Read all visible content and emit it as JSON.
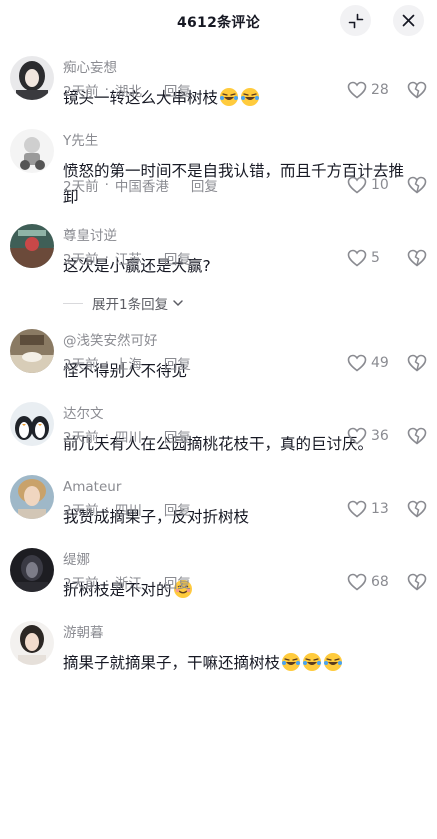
{
  "header": {
    "title": "4612条评论"
  },
  "comments": [
    {
      "username": "痴心妄想",
      "text": "镜头一转这么大串树枝",
      "emoji_count": 2,
      "time": "2天前",
      "location": "湖北",
      "reply_label": "回复",
      "likes": "28"
    },
    {
      "username": "Y先生",
      "text": "愤怒的第一时间不是自我认错，而且千方百计去推卸",
      "emoji_count": 0,
      "time": "2天前",
      "location": "中国香港",
      "reply_label": "回复",
      "likes": "10"
    },
    {
      "username": "尊皇讨逆",
      "text": "这次是小赢还是大赢?",
      "emoji_count": 0,
      "time": "2天前",
      "location": "江苏",
      "reply_label": "回复",
      "likes": "5"
    },
    {
      "username": "@浅笑安然可好",
      "text": "怪不得别人不待见",
      "emoji_count": 0,
      "time": "2天前",
      "location": "上海",
      "reply_label": "回复",
      "likes": "49"
    },
    {
      "username": "达尔文",
      "text": "前几天有人在公园摘桃花枝干，真的巨讨厌。",
      "emoji_count": 0,
      "time": "2天前",
      "location": "四川",
      "reply_label": "回复",
      "likes": "36"
    },
    {
      "username": "Amateur",
      "text": "我赞成摘果子，反对折树枝",
      "emoji_count": 0,
      "time": "2天前",
      "location": "四川",
      "reply_label": "回复",
      "likes": "13"
    },
    {
      "username": "缇娜",
      "text": "折树枝是不对的",
      "emoji_count": 0,
      "time": "2天前",
      "location": "浙江",
      "reply_label": "回复",
      "likes": "68"
    },
    {
      "username": "游朝暮",
      "text": "摘果子就摘果子，干嘛还摘树枝",
      "emoji_count": 3
    }
  ],
  "expand_replies": {
    "label": "展开1条回复"
  },
  "icons": {
    "collapse": "collapse-icon",
    "close": "close-icon",
    "like": "heart-icon",
    "dislike": "broken-heart-icon",
    "chevron": "chevron-down-icon",
    "laugh": "laughing-tears-emoji",
    "smile": "shy-smile-emoji"
  },
  "colors": {
    "text": "#161823",
    "secondary": "#8a8b91",
    "button_bg": "#f2f2f4"
  }
}
